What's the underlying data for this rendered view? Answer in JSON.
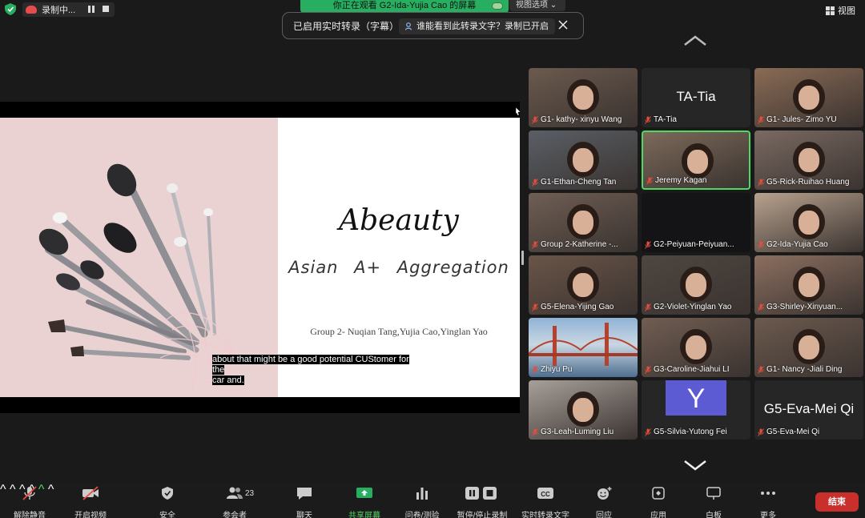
{
  "colors": {
    "accent_green": "#27ae60",
    "end_red": "#c9302c",
    "avatar_purple": "#5d5bd4",
    "active_border": "#4cd964"
  },
  "topbar": {
    "recording_label": "录制中...",
    "viewing_banner": "你正在观看 G2-Ida-Yujia Cao 的屏幕",
    "view_options": "视图选项 ⌄",
    "view_label": "视图"
  },
  "transcript": {
    "label": "已启用实时转录（字幕）",
    "who_can_see": "谁能看到此转录文字？录制已开启"
  },
  "slide": {
    "title": "Abeauty",
    "subtitle": "Asian  A+  Aggregation",
    "group": "Group 2- Nuqian Tang,Yujia  Cao,Yinglan Yao"
  },
  "caption": {
    "line1": "about that might be a good potential CUStomer for",
    "line2": "the",
    "line3": "car and."
  },
  "participants": [
    {
      "name": "G1- kathy- xinyu Wang",
      "type": "video"
    },
    {
      "name": "TA-Tia",
      "type": "name",
      "big": "TA-Tia"
    },
    {
      "name": "G1- Jules- Zimo YU",
      "type": "video"
    },
    {
      "name": "G1-Ethan-Cheng Tan",
      "type": "video"
    },
    {
      "name": "Jeremy Kagan",
      "type": "video",
      "active": true
    },
    {
      "name": "G5-Rick-Ruihao Huang",
      "type": "video"
    },
    {
      "name": "Group 2-Katherine -...",
      "type": "video"
    },
    {
      "name": "G2-Peiyuan-Peiyuan...",
      "type": "dark"
    },
    {
      "name": "G2-Ida-Yujia Cao",
      "type": "video"
    },
    {
      "name": "G5-Elena-Yijing Gao",
      "type": "video"
    },
    {
      "name": "G2-Violet-Yinglan Yao",
      "type": "video"
    },
    {
      "name": "G3-Shirley-Xinyuan...",
      "type": "video"
    },
    {
      "name": "Zhiyu Pu",
      "type": "bridge"
    },
    {
      "name": "G3-Caroline-Jiahui LI",
      "type": "video"
    },
    {
      "name": "G1- Nancy -Jiali Ding",
      "type": "video"
    },
    {
      "name": "G3-Leah-Luming Liu",
      "type": "video"
    },
    {
      "name": "G5-Silvia-Yutong Fei",
      "type": "avatar",
      "letter": "Y"
    },
    {
      "name": "G5-Eva-Mei Qi",
      "type": "name",
      "big": "G5-Eva-Mei Qi"
    }
  ],
  "toolbar": {
    "unmute": "解除静音",
    "start_video": "开启视频",
    "security": "安全",
    "participants": "参会者",
    "participants_count": "23",
    "chat": "聊天",
    "share_screen": "共享屏幕",
    "polls": "问卷/测验",
    "pause_stop_recording": "暂停/停止录制",
    "live_transcript": "实时转录文字",
    "reactions": "回应",
    "apps": "应用",
    "whiteboard": "白板",
    "more": "更多",
    "end": "结束"
  }
}
